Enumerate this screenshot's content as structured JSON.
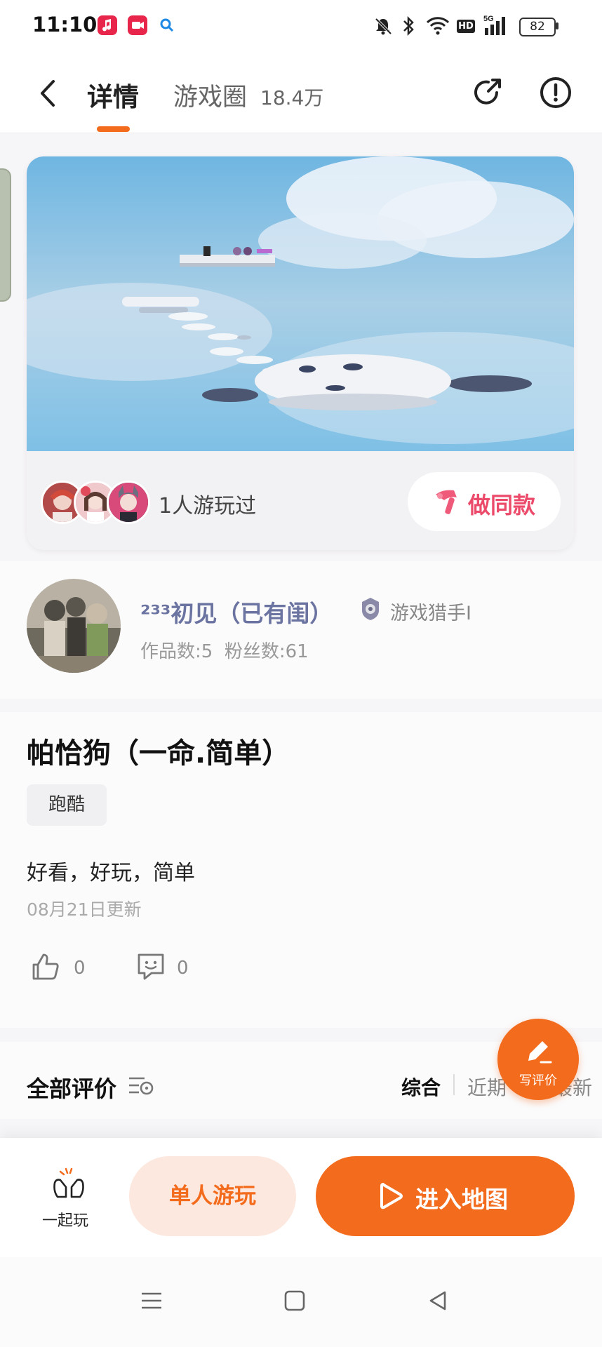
{
  "status_bar": {
    "time": "11:10",
    "battery": "82"
  },
  "nav": {
    "tab_detail": "详情",
    "tab_circle": "游戏圈",
    "tab_circle_count": "18.4万"
  },
  "card": {
    "played_text": "1人游玩过",
    "make_same_label": "做同款"
  },
  "author": {
    "name": "²³³初见（已有闺）",
    "badge_text": "游戏猎手I",
    "stats": "作品数:5  粉丝数:61"
  },
  "detail": {
    "title": "帕恰狗（一命.简单）",
    "tag": "跑酷",
    "description": "好看，好玩，简单",
    "updated": "08月21日更新",
    "likes": "0",
    "comments": "0"
  },
  "reviews": {
    "title": "全部评价",
    "sort_general": "综合",
    "sort_recent": "近期",
    "sort_latest": "最新",
    "write_review": "写评价"
  },
  "bottom": {
    "play_together": "一起玩",
    "single_play": "单人游玩",
    "enter_map": "进入地图"
  },
  "colors": {
    "accent": "#f36b1c",
    "make_same": "#ec4a6a",
    "author_name": "#6b73a0"
  }
}
